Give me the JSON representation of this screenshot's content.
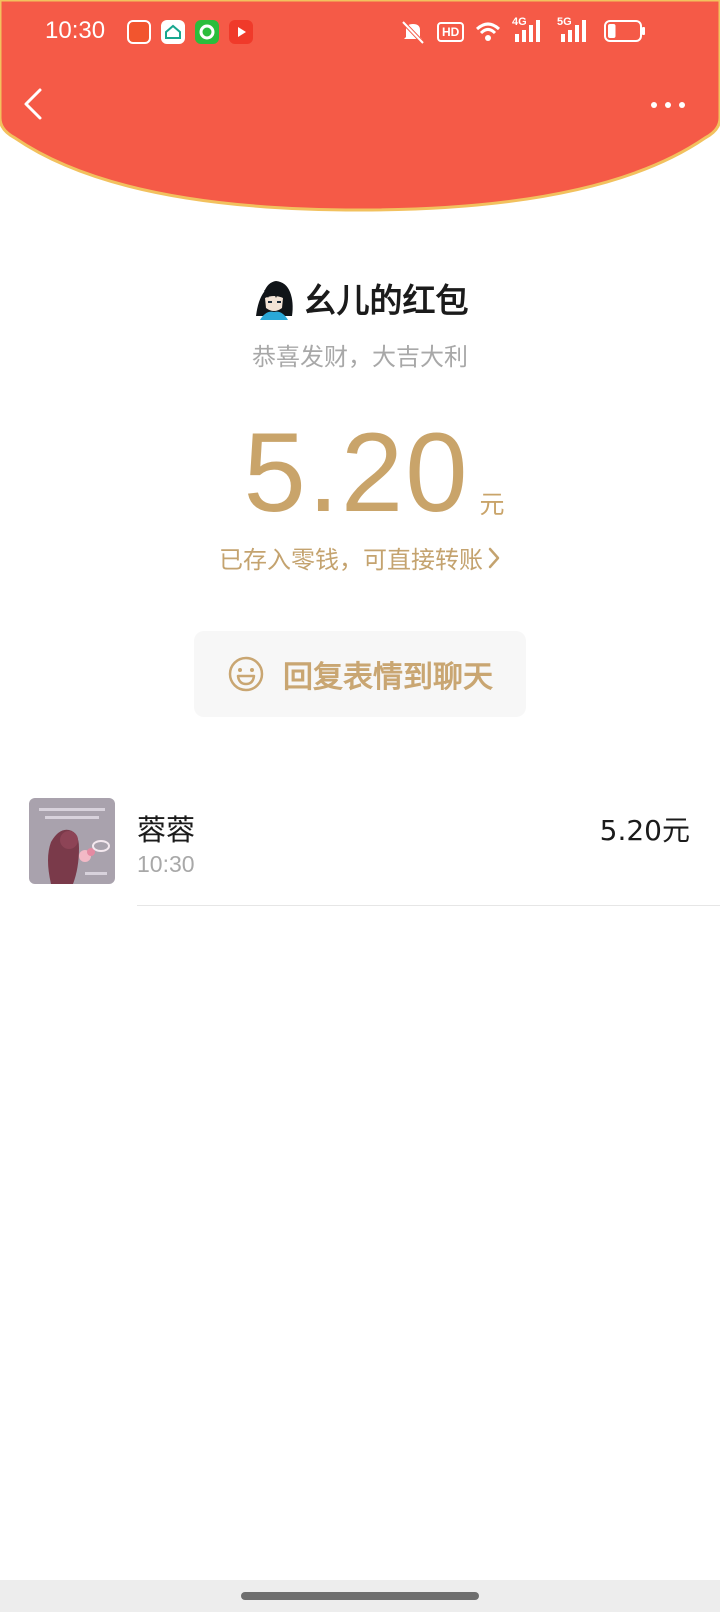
{
  "status_bar": {
    "time": "10:30",
    "hd_label": "HD",
    "network_1": "4G",
    "network_2": "5G",
    "icons": [
      "app-icon-red",
      "app-icon-teal",
      "app-icon-green",
      "app-icon-video",
      "mute-bell-icon",
      "wifi-icon",
      "signal-icon",
      "battery-icon"
    ],
    "battery_level": 0.25
  },
  "header": {
    "background_color": "#f55a47",
    "edge_color": "#f2c15e"
  },
  "sender": {
    "name": "幺儿的红包",
    "blessing": "恭喜发财，大吉大利"
  },
  "amount": {
    "value": "5.20",
    "unit": "元",
    "color": "#c9a46a"
  },
  "change_link": {
    "label": "已存入零钱，可直接转账"
  },
  "reply_button": {
    "label": "回复表情到聊天"
  },
  "receivers": [
    {
      "name": "蓉蓉",
      "time": "10:30",
      "amount": "5.20元"
    }
  ]
}
